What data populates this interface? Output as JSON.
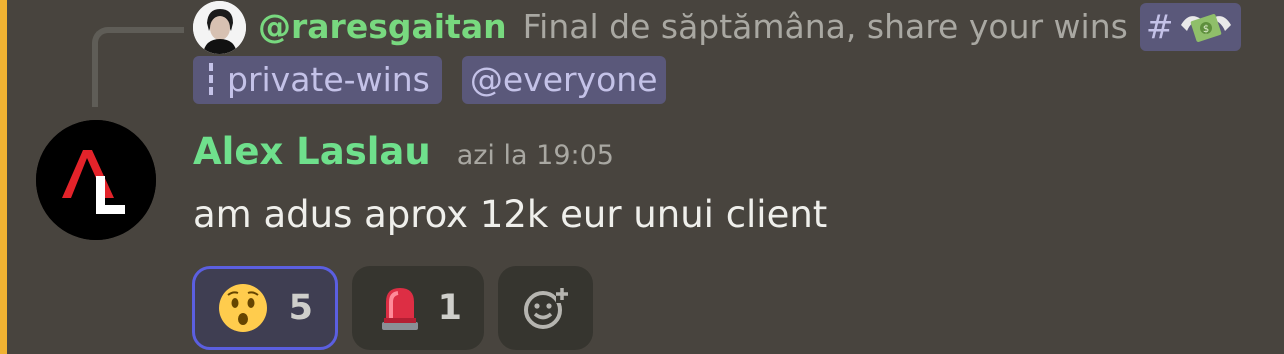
{
  "reply": {
    "author": "@raresgaitan",
    "text": "Final de săptămâna, share your wins",
    "channel_hash": "#",
    "channel_name": "private-wins",
    "mention": "@everyone"
  },
  "message": {
    "author": "Alex Laslau",
    "timestamp": "azi la 19:05",
    "text": "am adus aprox 12k eur unui client"
  },
  "reactions": [
    {
      "emoji": "astonished-face",
      "count": "5",
      "active": true
    },
    {
      "emoji": "police-light",
      "count": "1",
      "active": false
    }
  ],
  "colors": {
    "background": "#48443e",
    "mention_bar": "#f0b232",
    "author": "#6fe08c",
    "active_reaction_border": "#5b5fe0"
  }
}
